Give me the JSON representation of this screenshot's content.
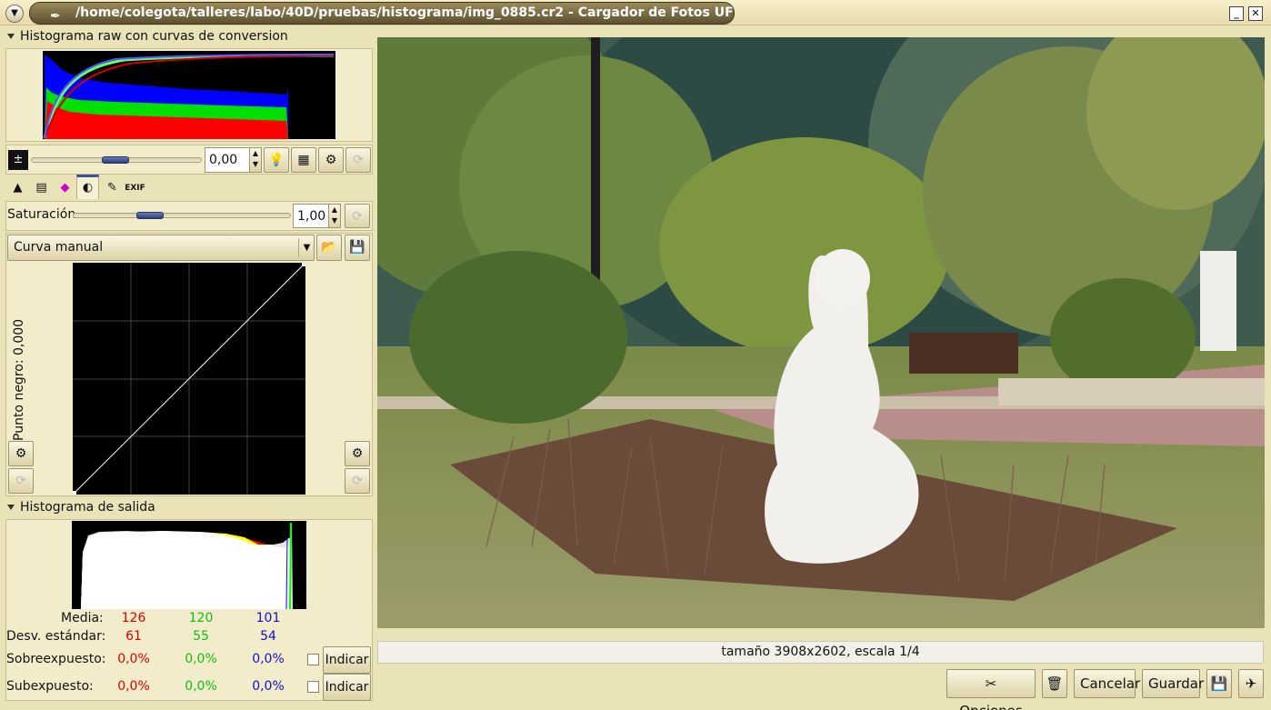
{
  "window": {
    "title": "/home/colegota/talleres/labo/40D/pruebas/histograma/img_0885.cr2 - Cargador de Fotos UFRaw"
  },
  "raw_histogram": {
    "title": "Histograma raw con curvas de conversion"
  },
  "exposure": {
    "value": "0,00"
  },
  "tabs": [
    {
      "icon": "raw-colors-icon"
    },
    {
      "icon": "curve-grid-icon"
    },
    {
      "icon": "color-management-icon"
    },
    {
      "icon": "corrections-icon"
    },
    {
      "icon": "lens-tools-icon"
    },
    {
      "icon": "exif-icon"
    }
  ],
  "saturation": {
    "label": "Saturación",
    "value": "1,00"
  },
  "curve": {
    "selected": "Curva manual",
    "black_point_label": "Punto negro: 0,000"
  },
  "output_histogram": {
    "title": "Histograma de salida"
  },
  "stats": {
    "mean_label": "Media:",
    "mean": [
      "126",
      "120",
      "101"
    ],
    "std_label": "Desv. estándar:",
    "std": [
      "61",
      "55",
      "54"
    ],
    "over_label": "Sobreexpuesto:",
    "over": [
      "0,0%",
      "0,0%",
      "0,0%"
    ],
    "under_label": "Subexpuesto:",
    "under": [
      "0,0%",
      "0,0%",
      "0,0%"
    ],
    "indicate_label": "Indicar",
    "colors": [
      "#e00000",
      "#10c010",
      "#1010d0"
    ]
  },
  "status": {
    "text": "tamaño 3908x2602, escala 1/4"
  },
  "buttons": {
    "options": "Opciones",
    "cancel": "Cancelar",
    "save": "Guardar"
  }
}
